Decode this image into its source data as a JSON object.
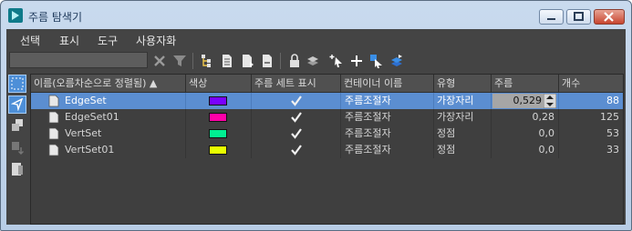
{
  "window": {
    "title": "주름 탐색기"
  },
  "menu": [
    "선택",
    "표시",
    "도구",
    "사용자화"
  ],
  "toolbar": {
    "search_placeholder": ""
  },
  "columns": [
    "이름(오름차순으로 정렬됨) ▲",
    "색상",
    "주름 세트 표시",
    "컨테이너 이름",
    "유형",
    "주름",
    "개수"
  ],
  "rows": [
    {
      "name": "EdgeSet",
      "color": "#7a00ff",
      "shown": true,
      "container": "주름조절자",
      "type": "가장자리",
      "crease": "0,529",
      "count": "88",
      "selected": true
    },
    {
      "name": "EdgeSet01",
      "color": "#ff00a8",
      "shown": true,
      "container": "주름조절자",
      "type": "가장자리",
      "crease": "0,28",
      "count": "125",
      "selected": false
    },
    {
      "name": "VertSet",
      "color": "#00ef92",
      "shown": true,
      "container": "주름조절자",
      "type": "정점",
      "crease": "0,0",
      "count": "53",
      "selected": false
    },
    {
      "name": "VertSet01",
      "color": "#e8ff00",
      "shown": true,
      "container": "주름조절자",
      "type": "정점",
      "crease": "0,0",
      "count": "33",
      "selected": false
    }
  ]
}
